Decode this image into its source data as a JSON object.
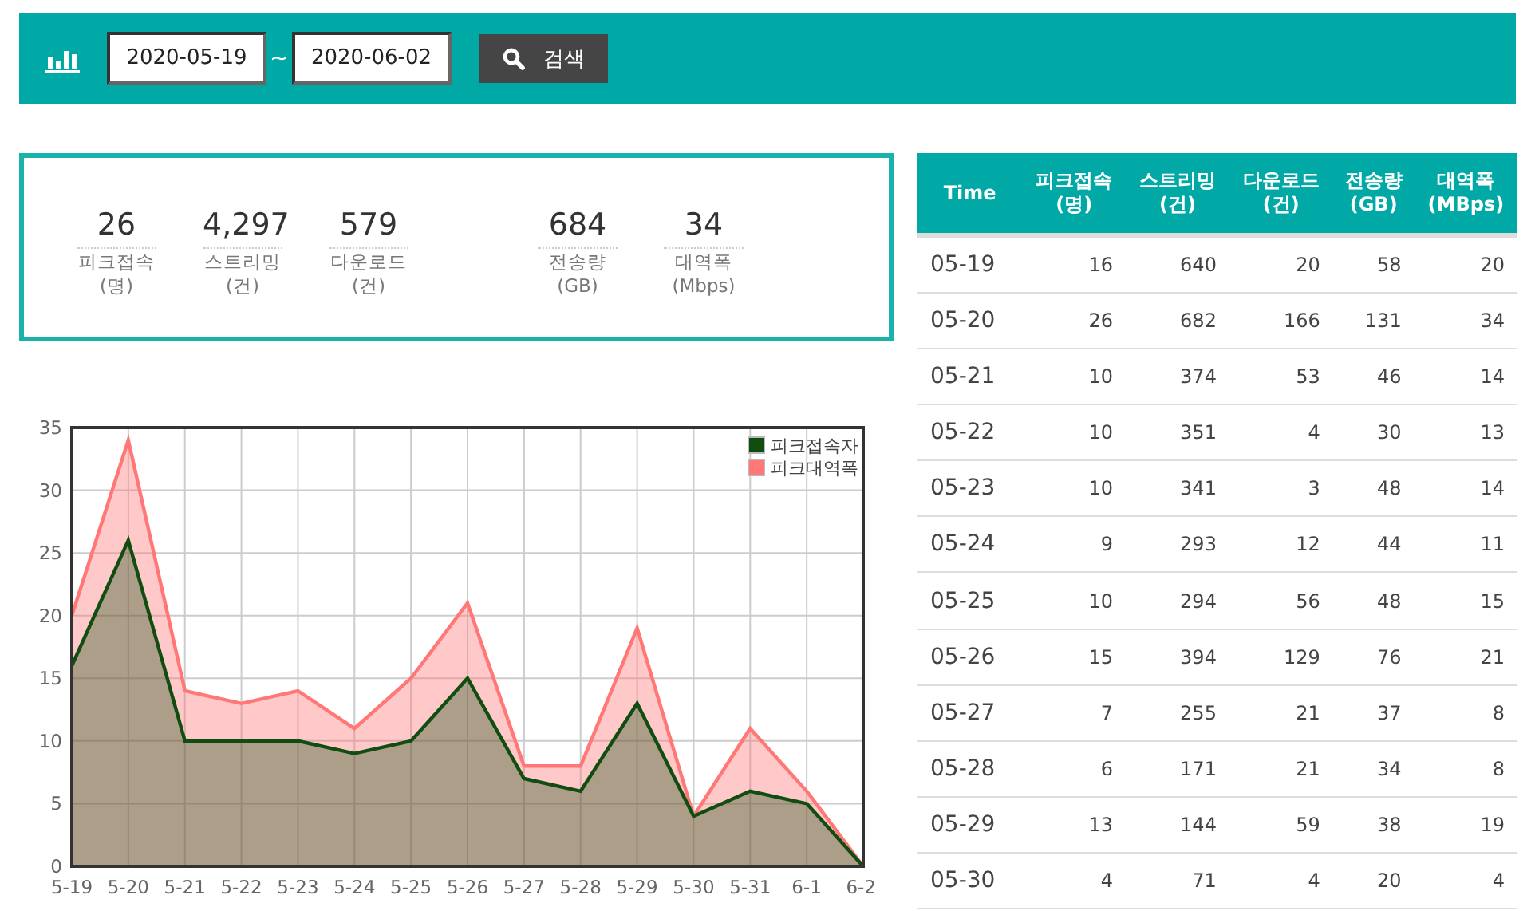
{
  "search_bar": {
    "start_date": "2020-05-19",
    "separator": "~",
    "end_date": "2020-06-02",
    "button": "검색"
  },
  "stat_groups": [
    {
      "items": [
        {
          "value": "26",
          "label": "피크접속",
          "unit": "(명)"
        },
        {
          "value": "4,297",
          "label": "스트리밍",
          "unit": "(건)"
        },
        {
          "value": "579",
          "label": "다운로드",
          "unit": "(건)"
        }
      ]
    },
    {
      "items": [
        {
          "value": "684",
          "label": "전송량",
          "unit": "(GB)"
        },
        {
          "value": "34",
          "label": "대역폭",
          "unit": "(Mbps)"
        }
      ]
    }
  ],
  "chart": {
    "chart_data": {
      "type": "area",
      "categories": [
        "5-19",
        "5-20",
        "5-21",
        "5-22",
        "5-23",
        "5-24",
        "5-25",
        "5-26",
        "5-27",
        "5-28",
        "5-29",
        "5-30",
        "5-31",
        "6-1",
        "6-2"
      ],
      "ylim": [
        0,
        35
      ],
      "yticks": [
        0,
        5,
        10,
        15,
        20,
        25,
        30,
        35
      ],
      "stacked": false,
      "grid": true,
      "legend": "top-right",
      "series": [
        {
          "name": "피크대역폭",
          "color": "#ff7777",
          "values": [
            20,
            34,
            14,
            13,
            14,
            11,
            15,
            21,
            8,
            8,
            19,
            4,
            11,
            6,
            0
          ]
        },
        {
          "name": "피크접속자",
          "color": "#114d11",
          "values": [
            16,
            26,
            10,
            10,
            10,
            9,
            10,
            15,
            7,
            6,
            13,
            4,
            6,
            5,
            0
          ]
        }
      ]
    }
  },
  "table": {
    "columns": [
      "Time",
      "피크접속\n(명)",
      "스트리밍\n(건)",
      "다운로드\n(건)",
      "전송량\n(GB)",
      "대역폭\n(MBps)"
    ],
    "rows": [
      [
        "05-19",
        "16",
        "640",
        "20",
        "58",
        "20"
      ],
      [
        "05-20",
        "26",
        "682",
        "166",
        "131",
        "34"
      ],
      [
        "05-21",
        "10",
        "374",
        "53",
        "46",
        "14"
      ],
      [
        "05-22",
        "10",
        "351",
        "4",
        "30",
        "13"
      ],
      [
        "05-23",
        "10",
        "341",
        "3",
        "48",
        "14"
      ],
      [
        "05-24",
        "9",
        "293",
        "12",
        "44",
        "11"
      ],
      [
        "05-25",
        "10",
        "294",
        "56",
        "48",
        "15"
      ],
      [
        "05-26",
        "15",
        "394",
        "129",
        "76",
        "21"
      ],
      [
        "05-27",
        "7",
        "255",
        "21",
        "37",
        "8"
      ],
      [
        "05-28",
        "6",
        "171",
        "21",
        "34",
        "8"
      ],
      [
        "05-29",
        "13",
        "144",
        "59",
        "38",
        "19"
      ],
      [
        "05-30",
        "4",
        "71",
        "4",
        "20",
        "4"
      ]
    ]
  }
}
